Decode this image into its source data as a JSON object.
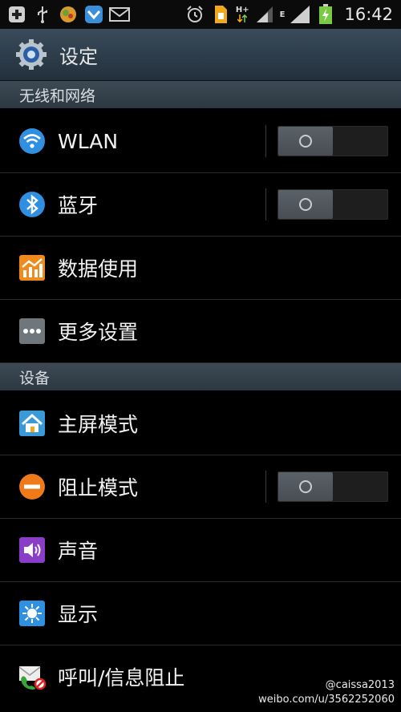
{
  "status_bar": {
    "time": "16:42",
    "network_type": "H+",
    "network_e": "E",
    "icons": [
      "add-icon",
      "usb-icon",
      "app-icon",
      "shield-app-icon",
      "mail-icon",
      "alarm-icon",
      "sim-icon",
      "signal-icon",
      "signal2-icon",
      "battery-charging-icon"
    ]
  },
  "action_bar": {
    "title": "设定",
    "icon": "settings-gear-icon"
  },
  "sections": [
    {
      "label": "无线和网络"
    },
    {
      "label": "设备"
    }
  ],
  "rows": [
    {
      "label": "WLAN",
      "icon": "wifi-icon",
      "toggle": "off"
    },
    {
      "label": "蓝牙",
      "icon": "bluetooth-icon",
      "toggle": "off"
    },
    {
      "label": "数据使用",
      "icon": "data-usage-icon"
    },
    {
      "label": "更多设置",
      "icon": "more-icon"
    },
    {
      "label": "主屏模式",
      "icon": "home-screen-icon"
    },
    {
      "label": "阻止模式",
      "icon": "block-mode-icon",
      "toggle": "off"
    },
    {
      "label": "声音",
      "icon": "sound-icon"
    },
    {
      "label": "显示",
      "icon": "display-icon"
    },
    {
      "label": "呼叫/信息阻止",
      "icon": "call-block-icon"
    }
  ],
  "watermark": {
    "handle": "@caissa2013",
    "url": "weibo.com/u/3562252060"
  },
  "colors": {
    "accent": "#2f8fe0",
    "section_bg": "#34414c",
    "toggle_off": "#4e555b"
  }
}
